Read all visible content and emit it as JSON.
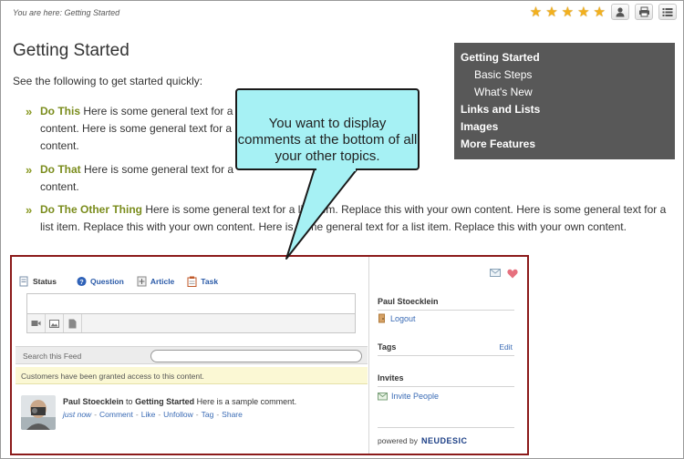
{
  "breadcrumb": {
    "text": "You are here: Getting Started"
  },
  "toolbar": {
    "rating_stars": 5,
    "icons": [
      "user-icon",
      "print-icon",
      "menu-icon"
    ]
  },
  "topic": {
    "title": "Getting Started",
    "intro": "See the following to get started quickly:",
    "bullets": [
      {
        "term": "Do This",
        "lines": [
          "Here is some general text for a",
          "content. Here is some general text for a",
          "content."
        ]
      },
      {
        "term": "Do That",
        "lines": [
          "Here is some general text for a",
          "content."
        ]
      },
      {
        "term": "Do The Other Thing",
        "lines": [
          "Here is some general text for a list item. Replace this with your own content. Here is some general text for a",
          "list item. Replace this with your own content. Here is some general text for a list item. Replace this with your own content."
        ]
      }
    ]
  },
  "toc": {
    "items": [
      {
        "label": "Getting Started",
        "level": 1
      },
      {
        "label": "Basic Steps",
        "level": 2
      },
      {
        "label": "What's New",
        "level": 2
      },
      {
        "label": "Links and Lists",
        "level": 1
      },
      {
        "label": "Images",
        "level": 1
      },
      {
        "label": "More Features",
        "level": 1
      }
    ]
  },
  "callout": {
    "text": "You want to display comments at the bottom of all your other topics."
  },
  "feed": {
    "tabs": [
      {
        "label": "Status",
        "icon": "status-icon"
      },
      {
        "label": "Question",
        "icon": "question-icon"
      },
      {
        "label": "Article",
        "icon": "article-icon"
      },
      {
        "label": "Task",
        "icon": "task-icon"
      }
    ],
    "search_label": "Search this Feed",
    "notice": "Customers have been granted access to this content.",
    "comment": {
      "author": "Paul Stoecklein",
      "connector": "to",
      "topic": "Getting Started",
      "text": "Here is a sample comment.",
      "actions": [
        "just now",
        "Comment",
        "Like",
        "Unfollow",
        "Tag",
        "Share"
      ]
    }
  },
  "profile": {
    "name": "Paul Stoecklein",
    "logout": "Logout",
    "tags_label": "Tags",
    "edit": "Edit",
    "invites_label": "Invites",
    "invite_people": "Invite People",
    "powered_by": "powered by",
    "brand": "NEUDESIC"
  }
}
